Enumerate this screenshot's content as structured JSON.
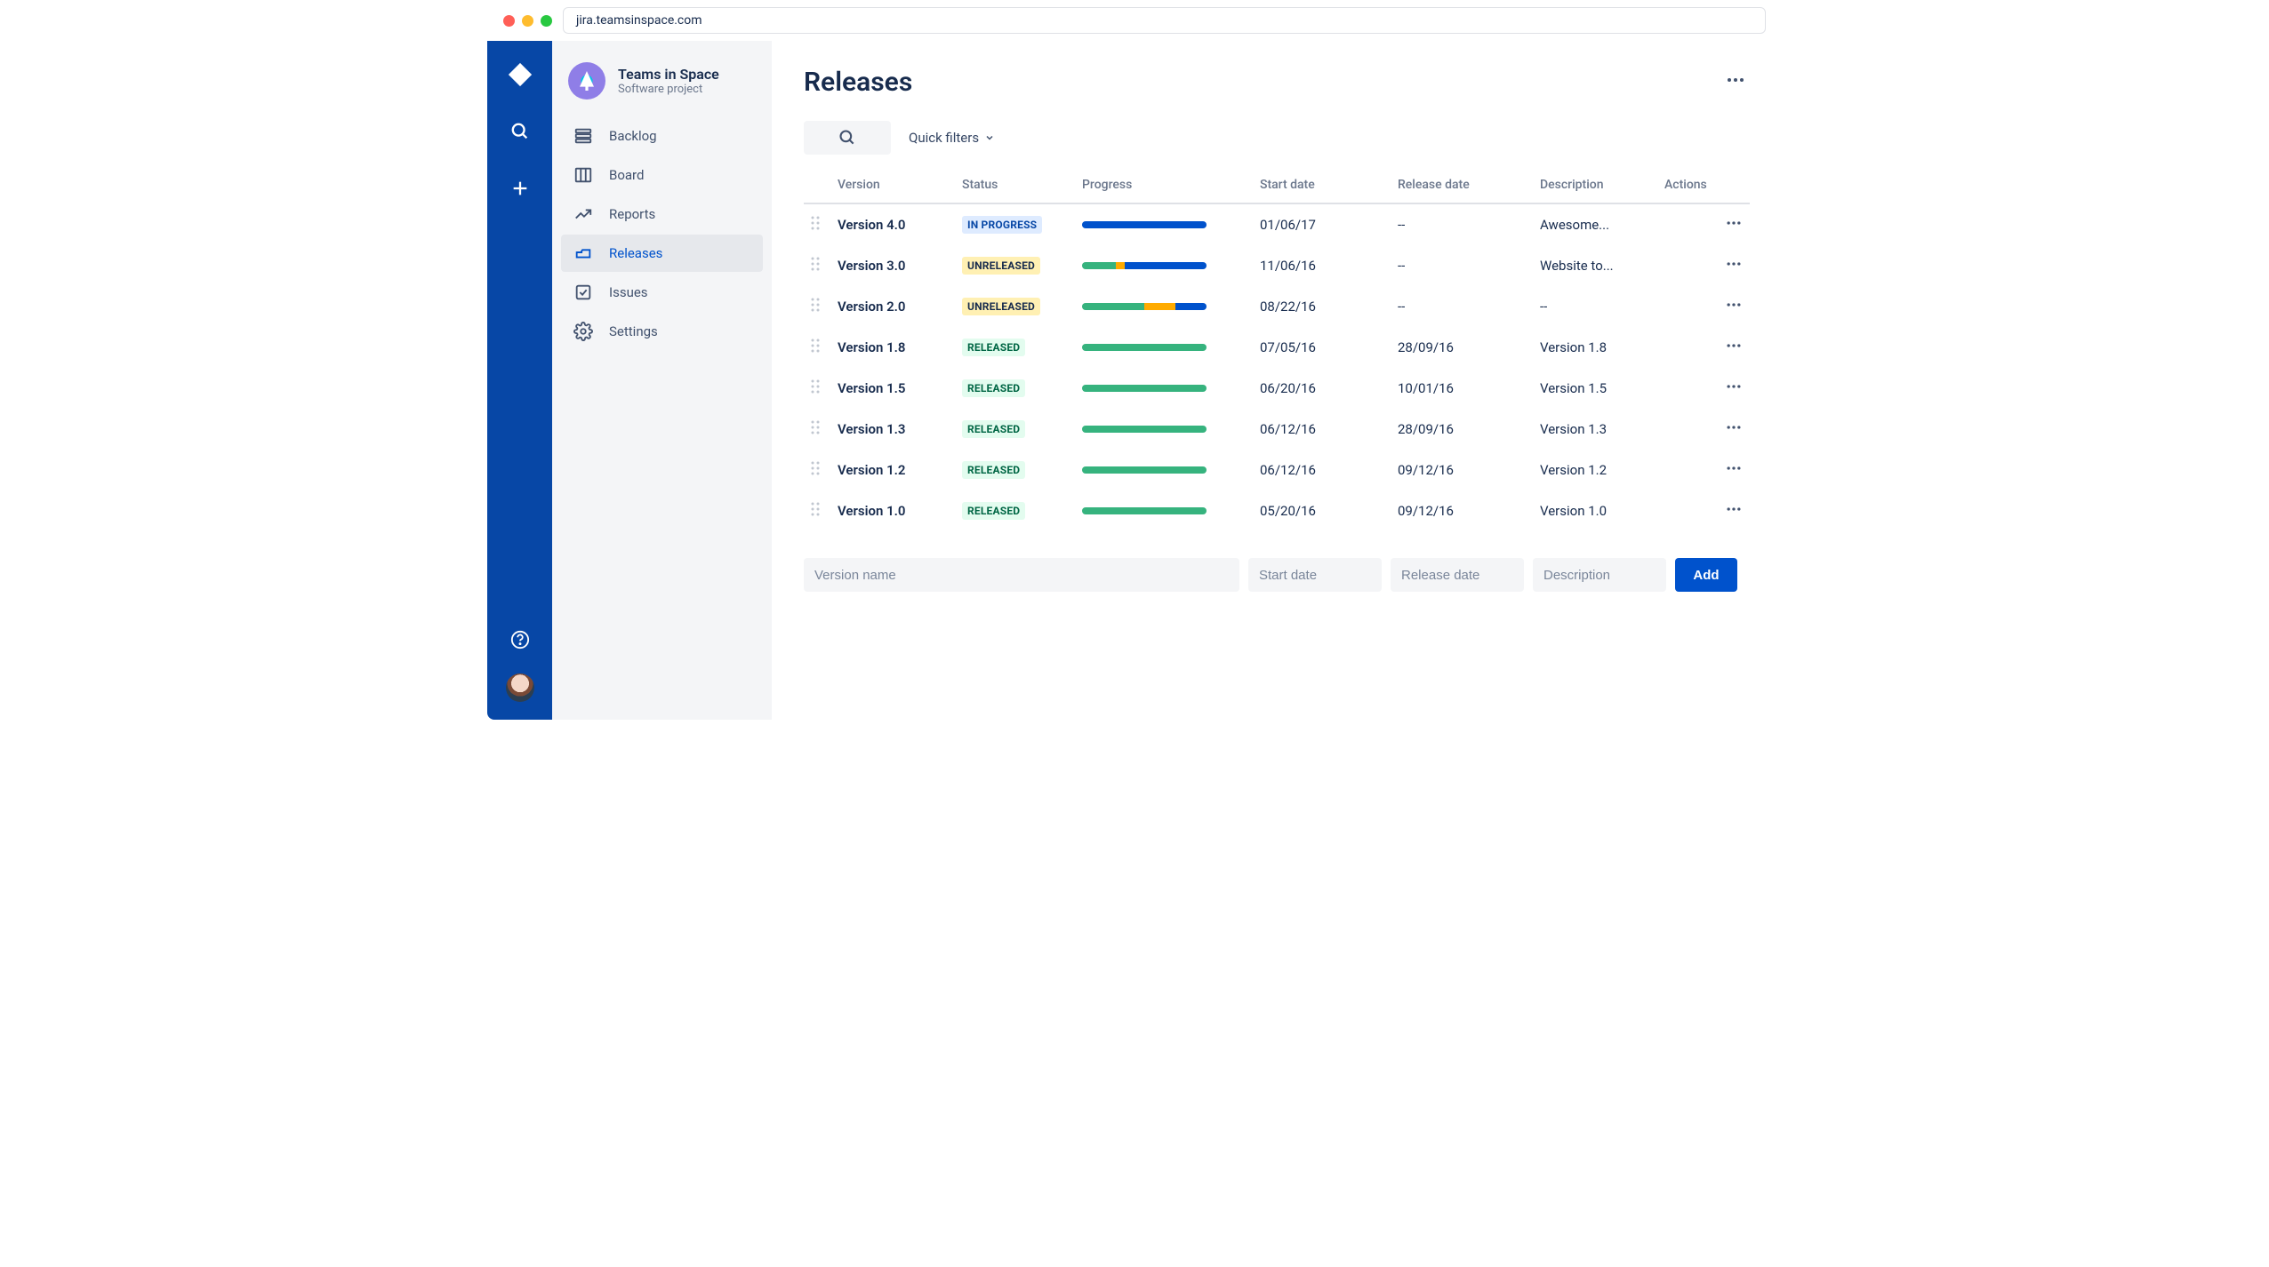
{
  "browser": {
    "url": "jira.teamsinspace.com"
  },
  "project": {
    "name": "Teams in Space",
    "type": "Software project"
  },
  "nav": {
    "items": [
      {
        "label": "Backlog",
        "icon": "backlog-icon"
      },
      {
        "label": "Board",
        "icon": "board-icon"
      },
      {
        "label": "Reports",
        "icon": "reports-icon"
      },
      {
        "label": "Releases",
        "icon": "releases-icon"
      },
      {
        "label": "Issues",
        "icon": "issues-icon"
      },
      {
        "label": "Settings",
        "icon": "settings-icon"
      }
    ],
    "active_index": 3
  },
  "page": {
    "title": "Releases",
    "quick_filters_label": "Quick filters"
  },
  "table": {
    "columns": {
      "version": "Version",
      "status": "Status",
      "progress": "Progress",
      "start_date": "Start date",
      "release_date": "Release date",
      "description": "Description",
      "actions": "Actions"
    },
    "rows": [
      {
        "version": "Version 4.0",
        "status_label": "IN PROGRESS",
        "status_key": "INPROGRESS",
        "progress": {
          "green": 0,
          "yellow": 0,
          "blue": 100
        },
        "start_date": "01/06/17",
        "release_date": "--",
        "description": "Awesome..."
      },
      {
        "version": "Version 3.0",
        "status_label": "UNRELEASED",
        "status_key": "UNRELEASED",
        "progress": {
          "green": 27,
          "yellow": 7,
          "blue": 66
        },
        "start_date": "11/06/16",
        "release_date": "--",
        "description": "Website to..."
      },
      {
        "version": "Version 2.0",
        "status_label": "UNRELEASED",
        "status_key": "UNRELEASED",
        "progress": {
          "green": 50,
          "yellow": 25,
          "blue": 25
        },
        "start_date": "08/22/16",
        "release_date": "--",
        "description": "--"
      },
      {
        "version": "Version 1.8",
        "status_label": "RELEASED",
        "status_key": "RELEASED",
        "progress": {
          "green": 100,
          "yellow": 0,
          "blue": 0
        },
        "start_date": "07/05/16",
        "release_date": "28/09/16",
        "description": "Version 1.8"
      },
      {
        "version": "Version 1.5",
        "status_label": "RELEASED",
        "status_key": "RELEASED",
        "progress": {
          "green": 100,
          "yellow": 0,
          "blue": 0
        },
        "start_date": "06/20/16",
        "release_date": "10/01/16",
        "description": "Version 1.5"
      },
      {
        "version": "Version 1.3",
        "status_label": "RELEASED",
        "status_key": "RELEASED",
        "progress": {
          "green": 100,
          "yellow": 0,
          "blue": 0
        },
        "start_date": "06/12/16",
        "release_date": "28/09/16",
        "description": "Version 1.3"
      },
      {
        "version": "Version 1.2",
        "status_label": "RELEASED",
        "status_key": "RELEASED",
        "progress": {
          "green": 100,
          "yellow": 0,
          "blue": 0
        },
        "start_date": "06/12/16",
        "release_date": "09/12/16",
        "description": "Version 1.2"
      },
      {
        "version": "Version 1.0",
        "status_label": "RELEASED",
        "status_key": "RELEASED",
        "progress": {
          "green": 100,
          "yellow": 0,
          "blue": 0
        },
        "start_date": "05/20/16",
        "release_date": "09/12/16",
        "description": "Version 1.0"
      }
    ]
  },
  "add_form": {
    "version_placeholder": "Version name",
    "start_placeholder": "Start date",
    "release_placeholder": "Release date",
    "description_placeholder": "Description",
    "button_label": "Add"
  }
}
